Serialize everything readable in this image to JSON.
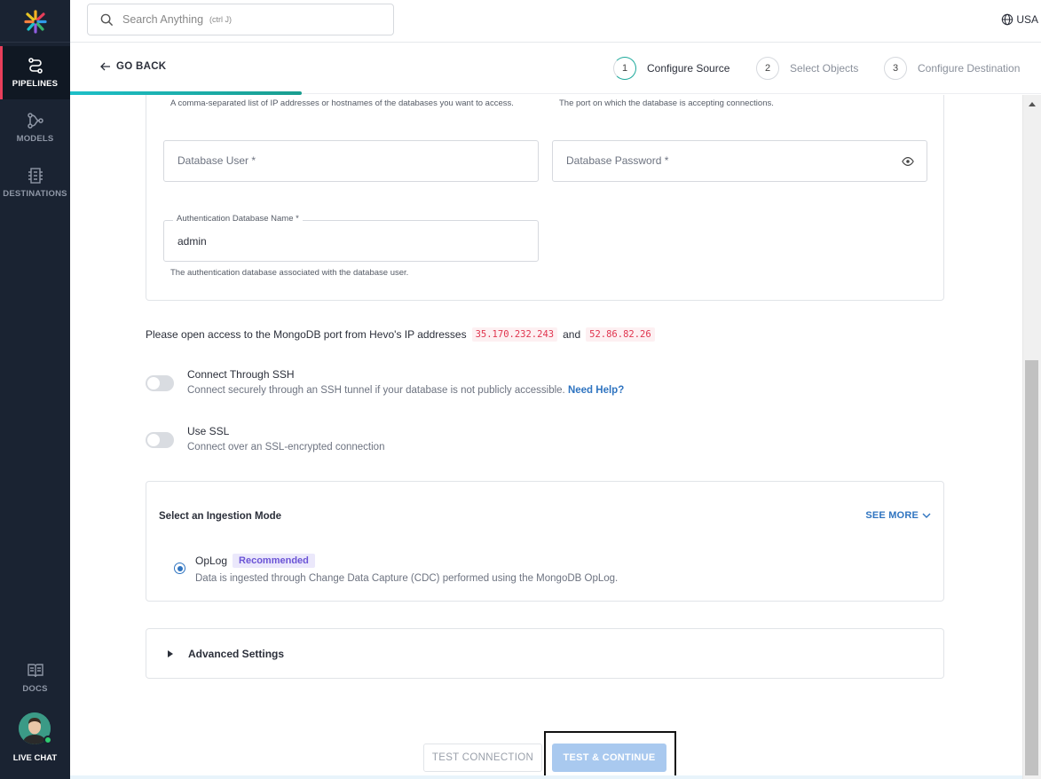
{
  "sidebar": {
    "items": [
      {
        "label": "PIPELINES",
        "icon": "pipelines-icon",
        "active": true
      },
      {
        "label": "MODELS",
        "icon": "models-icon",
        "active": false
      },
      {
        "label": "DESTINATIONS",
        "icon": "destinations-icon",
        "active": false
      }
    ],
    "docs_label": "DOCS",
    "livechat_label": "LIVE CHAT"
  },
  "topbar": {
    "search_placeholder": "Search Anything",
    "search_shortcut": "(ctrl J)",
    "region": "USA"
  },
  "subheader": {
    "go_back": "GO BACK",
    "steps": [
      {
        "number": "1",
        "label": "Configure Source"
      },
      {
        "number": "2",
        "label": "Select Objects"
      },
      {
        "number": "3",
        "label": "Configure Destination"
      }
    ]
  },
  "form": {
    "hosts_help": "A comma-separated list of IP addresses or hostnames of the databases you want to access.",
    "port_help": "The port on which the database is accepting connections.",
    "db_user_placeholder": "Database User *",
    "db_password_placeholder": "Database Password *",
    "auth_db_label": "Authentication Database Name *",
    "auth_db_value": "admin",
    "auth_db_help": "The authentication database associated with the database user."
  },
  "access": {
    "text": "Please open access to the MongoDB port from Hevo's IP addresses",
    "ip1": "35.170.232.243",
    "and": "and",
    "ip2": "52.86.82.26"
  },
  "ssh": {
    "title": "Connect Through SSH",
    "desc": "Connect securely through an SSH tunnel if your database is not publicly accessible.",
    "help_link": "Need Help?"
  },
  "ssl": {
    "title": "Use SSL",
    "desc": "Connect over an SSL-encrypted connection"
  },
  "ingestion": {
    "title": "Select an Ingestion Mode",
    "see_more": "SEE MORE",
    "option_label": "OpLog",
    "option_badge": "Recommended",
    "option_desc": "Data is ingested through Change Data Capture (CDC) performed using the MongoDB OpLog."
  },
  "advanced": {
    "label": "Advanced Settings"
  },
  "actions": {
    "test_connection": "TEST CONNECTION",
    "test_continue": "TEST & CONTINUE"
  },
  "colors": {
    "sidebar_bg": "#1a2332",
    "accent_blue": "#2f74c0",
    "ip_red": "#e0354f",
    "badge_purple": "#6b54d6",
    "progress_teal": "#1aa89a"
  }
}
